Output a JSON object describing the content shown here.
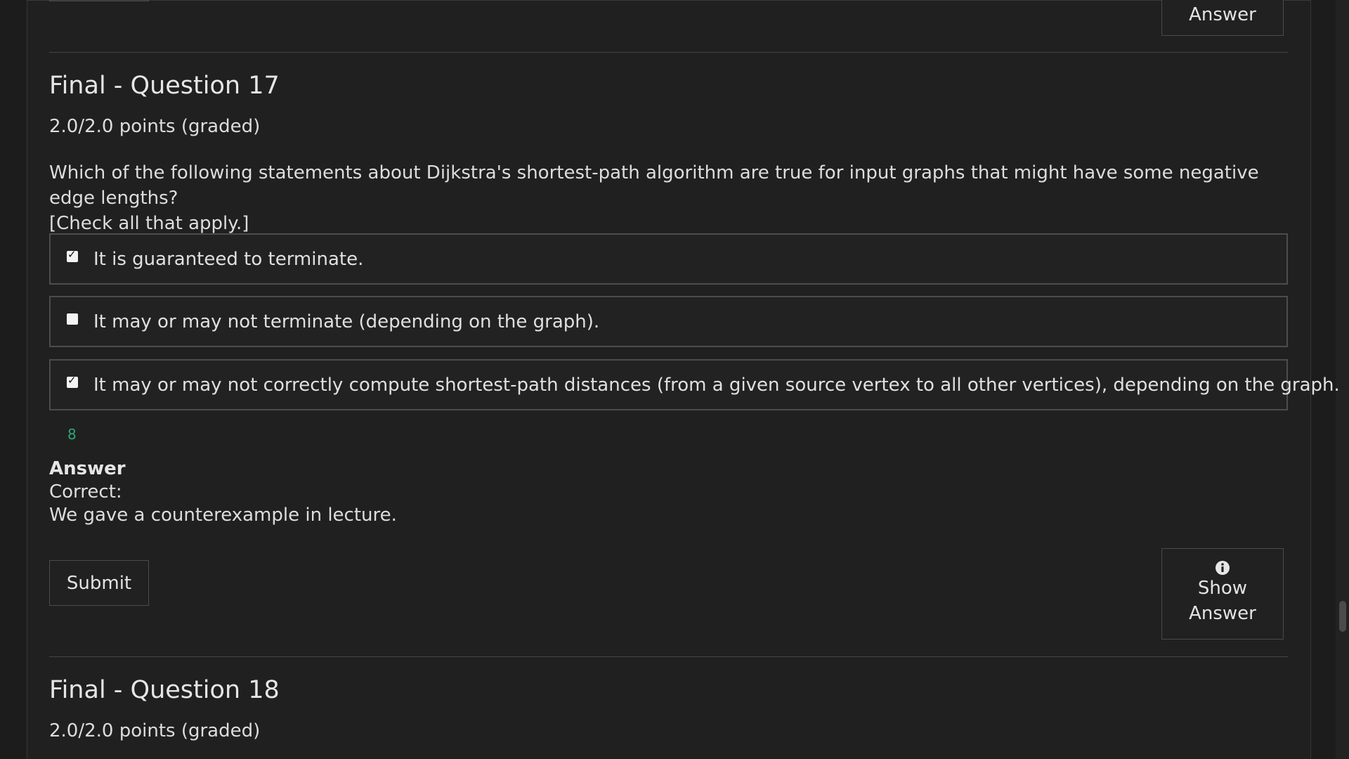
{
  "previous": {
    "answer_label": "Answer"
  },
  "q17": {
    "title": "Final - Question 17",
    "points": "2.0/2.0 points (graded)",
    "question_line1": "Which of the following statements about Dijkstra's shortest-path algorithm are true for input graphs that might have some negative edge lengths?",
    "question_line2": "[Check all that apply.]",
    "choices": [
      {
        "label": "It is guaranteed to terminate.",
        "checked": true
      },
      {
        "label": "It may or may not terminate (depending on the graph).",
        "checked": false
      },
      {
        "label": "It may or may not correctly compute shortest-path distances (from a given source vertex to all other vertices), depending on the graph.",
        "checked": true
      }
    ],
    "status_mark": "8",
    "answer_heading": "Answer",
    "answer_correct": "Correct:",
    "answer_explanation": "We gave a counterexample in lecture.",
    "submit_label": "Submit",
    "show_answer_line1": "Show",
    "show_answer_line2": "Answer",
    "show_answer_icon": "info-icon"
  },
  "q18": {
    "title": "Final - Question 18",
    "points": "2.0/2.0 points (graded)"
  }
}
